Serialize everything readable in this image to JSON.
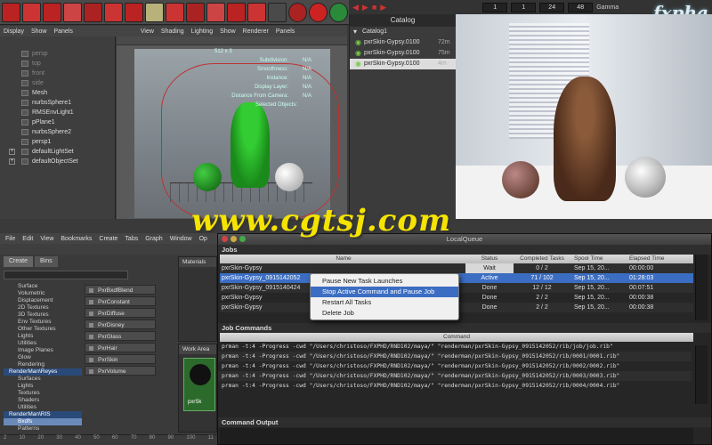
{
  "shelf": {
    "counter_values": [
      "1",
      "1",
      "24",
      "48"
    ],
    "gamma_label": "Gamma",
    "logo_text": "fxpha"
  },
  "maya": {
    "menu": [
      "Display",
      "Show",
      "Panels"
    ],
    "viewport_menu": [
      "View",
      "Shading",
      "Lighting",
      "Show",
      "Renderer",
      "Panels"
    ],
    "outliner": [
      {
        "label": "persp",
        "dim": true
      },
      {
        "label": "top",
        "dim": true
      },
      {
        "label": "front",
        "dim": true
      },
      {
        "label": "side",
        "dim": true
      },
      {
        "label": "Mesh",
        "dim": false
      },
      {
        "label": "nurbsSphere1",
        "dim": false
      },
      {
        "label": "RMSEnvLight1",
        "dim": false
      },
      {
        "label": "pPlane1",
        "dim": false
      },
      {
        "label": "nurbsSphere2",
        "dim": false
      },
      {
        "label": "persp1",
        "dim": false
      },
      {
        "label": "defaultLightSet",
        "dim": false
      },
      {
        "label": "defaultObjectSet",
        "dim": false
      }
    ],
    "hud": [
      {
        "label": "Subdivision:",
        "value": "N/A"
      },
      {
        "label": "Smoothness:",
        "value": "N/A"
      },
      {
        "label": "Instance:",
        "value": "N/A"
      },
      {
        "label": "Display Layer:",
        "value": "N/A"
      },
      {
        "label": "Distance From Camera:",
        "value": "N/A"
      },
      {
        "label": "Selected Objects:",
        "value": ""
      }
    ],
    "hud_res": "512 x 3"
  },
  "catalog": {
    "title": "Catalog",
    "root": "Catalog1",
    "items": [
      {
        "name": "pxrSkin-Gypsy.0100",
        "time": "72m"
      },
      {
        "name": "pxrSkin-Gypsy.0100",
        "time": "75m"
      },
      {
        "name": "pxrSkin-Gypsy.0100",
        "time": "4m"
      }
    ]
  },
  "watermark": "www.cgtsj.com",
  "hypershade": {
    "menu": [
      "File",
      "Edit",
      "View",
      "Bookmarks",
      "Create",
      "Tabs",
      "Graph",
      "Window",
      "Op"
    ],
    "tabs": [
      "Create",
      "Bins"
    ],
    "tree": [
      {
        "label": "Surface",
        "type": "item"
      },
      {
        "label": "Volumetric",
        "type": "item"
      },
      {
        "label": "Displacement",
        "type": "item"
      },
      {
        "label": "2D Textures",
        "type": "item"
      },
      {
        "label": "3D Textures",
        "type": "item"
      },
      {
        "label": "Env Textures",
        "type": "item"
      },
      {
        "label": "Other Textures",
        "type": "item"
      },
      {
        "label": "Lights",
        "type": "item"
      },
      {
        "label": "Utilities",
        "type": "item"
      },
      {
        "label": "Image Planes",
        "type": "item"
      },
      {
        "label": "Glow",
        "type": "item"
      },
      {
        "label": "Rendering",
        "type": "item"
      },
      {
        "label": "RenderMan\\Reyes",
        "type": "head"
      },
      {
        "label": "Surfaces",
        "type": "item"
      },
      {
        "label": "Lights",
        "type": "item"
      },
      {
        "label": "Textures",
        "type": "item"
      },
      {
        "label": "Shaders",
        "type": "item"
      },
      {
        "label": "Utilities",
        "type": "item"
      },
      {
        "label": "RenderMan\\RIS",
        "type": "head"
      },
      {
        "label": "Bxdfs",
        "type": "sel"
      },
      {
        "label": "Patterns",
        "type": "item"
      }
    ],
    "nodes": [
      "PxrBxdfBlend",
      "PxrConstant",
      "PxrDiffuse",
      "PxrDisney",
      "PxrGlass",
      "PxrHair",
      "PxrSkin",
      "PxrVolume"
    ],
    "materials_label": "Materials",
    "workarea_label": "Work Area",
    "swatch_label": "pxrSk",
    "timeline": [
      "2",
      "10",
      "20",
      "30",
      "40",
      "50",
      "60",
      "70",
      "80",
      "90",
      "100",
      "11"
    ]
  },
  "queue": {
    "title": "LocalQueue",
    "jobs_label": "Jobs",
    "columns": {
      "name": "Name",
      "status": "Status",
      "done": "Completed Tasks",
      "spool": "Spool Time",
      "elapsed": "Elapsed Time"
    },
    "jobs": [
      {
        "name": "pxrSkin-Gypsy",
        "status": "Wait",
        "done": "0 / 2",
        "spool": "Sep 15, 20...",
        "elapsed": "00:00:00"
      },
      {
        "name": "pxrSkin-Gypsy_0915142052",
        "status": "Active",
        "done": "71 / 102",
        "spool": "Sep 15, 20...",
        "elapsed": "01:28:03"
      },
      {
        "name": "pxrSkin-Gypsy_0915140424",
        "status": "Done",
        "done": "12 / 12",
        "spool": "Sep 15, 20...",
        "elapsed": "00:07:51"
      },
      {
        "name": "pxrSkin-Gypsy",
        "status": "Done",
        "done": "2 / 2",
        "spool": "Sep 15, 20...",
        "elapsed": "00:00:38"
      },
      {
        "name": "pxrSkin-Gypsy",
        "status": "Done",
        "done": "2 / 2",
        "spool": "Sep 15, 20...",
        "elapsed": "00:00:38"
      }
    ],
    "context_menu": [
      "Pause New Task Launches",
      "Stop Active Command and Pause Job",
      "Restart All Tasks",
      "Delete Job"
    ],
    "commands_label": "Job Commands",
    "command_col": "Command",
    "commands": [
      "prman -t:4 -Progress -cwd \"/Users/christoso/FXPHD/RND102/maya/\" \"renderman/pxrSkin-Gypsy_0915142052/rib/job/job.rib\"",
      "prman -t:4 -Progress -cwd \"/Users/christoso/FXPHD/RND102/maya/\" \"renderman/pxrSkin-Gypsy_0915142052/rib/0001/0001.rib\"",
      "prman -t:4 -Progress -cwd \"/Users/christoso/FXPHD/RND102/maya/\" \"renderman/pxrSkin-Gypsy_0915142052/rib/0002/0002.rib\"",
      "prman -t:4 -Progress -cwd \"/Users/christoso/FXPHD/RND102/maya/\" \"renderman/pxrSkin-Gypsy_0915142052/rib/0003/0003.rib\"",
      "prman -t:4 -Progress -cwd \"/Users/christoso/FXPHD/RND102/maya/\" \"renderman/pxrSkin-Gypsy_0915142052/rib/0004/0004.rib\""
    ],
    "output_label": "Command Output"
  }
}
